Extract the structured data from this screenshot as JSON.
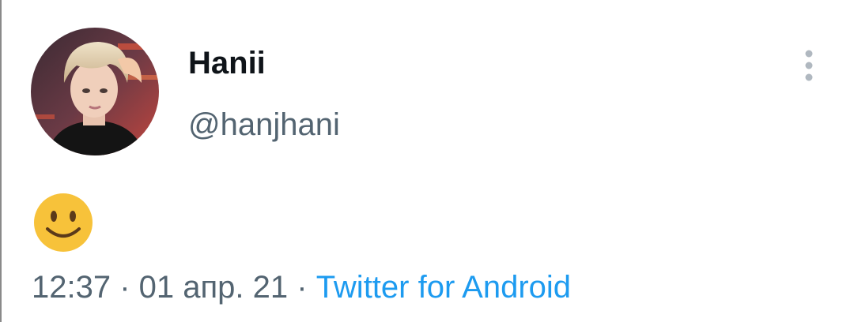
{
  "tweet": {
    "author": {
      "display_name": "Hanii",
      "handle": "@hanjhani",
      "avatar_icon": "profile-photo"
    },
    "text": "🙂",
    "meta": {
      "time": "12:37",
      "separator": " · ",
      "date": "01 апр. 21",
      "source": "Twitter for Android"
    },
    "menu_icon": "more-vertical-icon"
  },
  "colors": {
    "name": "#0f1419",
    "secondary": "#536471",
    "link": "#1d9bf0",
    "menu_dots": "#b0b8c0",
    "emoji": "#f7c23a"
  }
}
